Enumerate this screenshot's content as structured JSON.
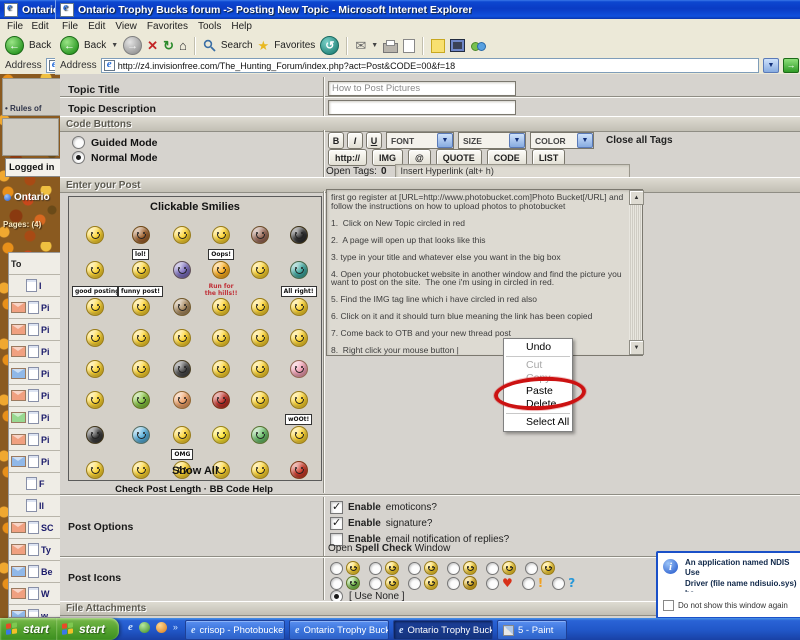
{
  "colors": {
    "titlebar_blue": "#0b47d0",
    "taskbar_blue": "#2a63d6",
    "start_green": "#58a532",
    "annotation_red": "#cc1212",
    "dialog_border": "#1a50c8",
    "page_gray": "#d6d3ce"
  },
  "outer_window": {
    "title": "Ontario Tr",
    "menu": "File   Edit   Vi",
    "back_label": "Back",
    "address_label": "Address",
    "address_value": "ht"
  },
  "window": {
    "title": "Ontario Trophy Bucks forum -> Posting New Topic - Microsoft Internet Explorer",
    "menu_items": [
      "File",
      "Edit",
      "View",
      "Favorites",
      "Tools",
      "Help"
    ],
    "toolbar": {
      "back_label": "Back",
      "search_label": "Search",
      "favorites_label": "Favorites"
    },
    "address_label": "Address",
    "address_value": "http://z4.invisionfree.com/The_Hunting_Forum/index.php?act=Post&CODE=00&f=18"
  },
  "left_panel": {
    "rules_link": "• Rules of",
    "logged_in": "Logged in",
    "ontario": "Ontario",
    "pages": "Pages: (4)",
    "rows": [
      {
        "h": "To"
      },
      {
        "t": "I"
      },
      {
        "e": "o",
        "t": "Pi"
      },
      {
        "e": "o",
        "t": "Pi"
      },
      {
        "e": "o",
        "t": "Pi"
      },
      {
        "e": "b",
        "t": "Pi"
      },
      {
        "e": "o",
        "t": "Pi"
      },
      {
        "e": "g",
        "t": "Pi"
      },
      {
        "e": "o",
        "t": "Pi"
      },
      {
        "e": "b",
        "t": "Pi"
      },
      {
        "t": "F"
      },
      {
        "t": "Il"
      },
      {
        "e": "o",
        "t": "SC"
      },
      {
        "e": "o",
        "t": "Ty"
      },
      {
        "e": "b",
        "t": "Be"
      },
      {
        "e": "o",
        "t": "W"
      },
      {
        "e": "b",
        "t": "w"
      }
    ]
  },
  "form": {
    "topic_title_label": "Topic Title",
    "topic_title_value": "How to Post Pictures",
    "topic_description_label": "Topic Description",
    "topic_description_value": "",
    "code_buttons_header": "Code Buttons",
    "guided_mode_label": "Guided Mode",
    "normal_mode_label": "Normal Mode",
    "style_buttons": [
      "B",
      "I",
      "U"
    ],
    "font_select": "FONT",
    "size_select": "SIZE",
    "color_select": "COLOR",
    "close_all_tags": "Close all Tags",
    "tag_buttons": [
      "http://",
      "IMG",
      "@",
      "QUOTE",
      "CODE",
      "LIST"
    ],
    "open_tags_label": "Open Tags:",
    "open_tags_count": "0",
    "hyperlink_hint": "Insert Hyperlink (alt+ h)",
    "enter_post_header": "Enter your Post",
    "smilies_title": "Clickable Smilies",
    "show_all_label": "Show All",
    "check_post_length_label": "Check Post Length",
    "links_separator": "·",
    "bb_code_help_label": "BB Code Help",
    "smilies": [
      [
        {
          "c": "#ffd630"
        },
        {
          "c": "#a0622d"
        },
        {
          "c": "#ffd630"
        },
        {
          "c": "#ffd630"
        },
        {
          "c": "#9a6a58"
        },
        {
          "c": "#2f2f2f"
        }
      ],
      [
        {
          "c": "#ffd630"
        },
        {
          "c": "#ffd630",
          "s": "lol!"
        },
        {
          "c": "#7d6fc0"
        },
        {
          "c": "#ffb020",
          "s": "Oops!"
        },
        {
          "c": "#ffd630"
        },
        {
          "c": "#3fa8a0"
        }
      ],
      [
        {
          "c": "#ffd630",
          "s": "good posting!"
        },
        {
          "c": "#ffd630",
          "s": "funny post!"
        },
        {
          "c": "#a98a5f"
        },
        {
          "c": "#ffd630",
          "r": "Run for\nthe hills!!"
        },
        {
          "c": "#ffd630"
        },
        {
          "c": "#ffd630",
          "s": "All right!"
        }
      ],
      [
        {
          "c": "#ffd630"
        },
        {
          "c": "#ffd630"
        },
        {
          "c": "#ffd630"
        },
        {
          "c": "#ffd630"
        },
        {
          "c": "#ffd630"
        },
        {
          "c": "#ffd630"
        }
      ],
      [
        {
          "c": "#ffd630"
        },
        {
          "c": "#ffd630"
        },
        {
          "c": "#4a4a4a"
        },
        {
          "c": "#ffd630"
        },
        {
          "c": "#ffd630"
        },
        {
          "c": "#f2a0b4"
        }
      ],
      [
        {
          "c": "#ffd630"
        },
        {
          "c": "#86c540"
        },
        {
          "c": "#f0a268"
        },
        {
          "c": "#c03028"
        },
        {
          "c": "#ffd630"
        },
        {
          "c": "#ffd630"
        }
      ],
      [
        {
          "c": "#3a3a3a"
        },
        {
          "c": "#57b0dc"
        },
        {
          "c": "#ffd630"
        },
        {
          "c": "#ffe630"
        },
        {
          "c": "#6abf69"
        },
        {
          "c": "#ffd630",
          "s": "wOOt!"
        }
      ],
      [
        {
          "c": "#ffd630"
        },
        {
          "c": "#ffd630"
        },
        {
          "c": "#ffd630",
          "s": "OMG"
        },
        {
          "c": "#ffd630"
        },
        {
          "c": "#ffd630"
        },
        {
          "c": "#cc3a2a"
        }
      ]
    ],
    "post_text": "first go register at [URL=http://www.photobucket.com]Photo Bucket[/URL] and follow the instructions on how to upload photos to photobucket\n\n1.  Click on New Topic circled in red\n\n2.  A page will open up that looks like this\n\n3. type in your title and whatever else you want in the big box\n\n4. Open your photobucket website in another window and find the picture you want to post on the site.  The one i'm using in circled in red.\n\n5. Find the IMG tag line which i have circled in red also\n\n6. Click on it and it should turn blue meaning the link has been copied\n\n7. Come back to OTB and your new thread post\n\n8.  Right click your mouse button |",
    "post_options_label": "Post Options",
    "options": [
      {
        "bold": "Enable",
        "rest": "emoticons?",
        "checked": true
      },
      {
        "bold": "Enable",
        "rest": "signature?",
        "checked": true
      },
      {
        "bold": "Enable",
        "rest": "email notification of replies?",
        "checked": false
      }
    ],
    "spell_check_prefix": "Open",
    "spell_check_bold": "Spell Check",
    "spell_check_suffix": "Window",
    "post_icons_label": "Post Icons",
    "post_icon_rows": [
      [
        {
          "c": "#ffd630"
        },
        {
          "c": "#ffd630"
        },
        {
          "c": "#ffd630"
        },
        {
          "c": "#ffd630"
        },
        {
          "c": "#ffd630"
        },
        {
          "c": "#ffd630"
        }
      ],
      [
        {
          "c": "#7ec850"
        },
        {
          "c": "#ffd630"
        },
        {
          "c": "#ffd630"
        },
        {
          "c": "#e8b820"
        },
        {
          "g": "♥",
          "c": "#d83018"
        },
        {
          "g": "!",
          "c": "#f0a020"
        },
        {
          "g": "?",
          "c": "#2898d8"
        }
      ]
    ],
    "use_none_label": "[ Use None ]",
    "file_attachments_header": "File Attachments"
  },
  "context_menu": {
    "items": [
      {
        "label": "Undo"
      },
      {
        "sep": true
      },
      {
        "label": "Cut",
        "disabled": true
      },
      {
        "label": "Copy",
        "disabled": true
      },
      {
        "label": "Paste",
        "circled": true
      },
      {
        "label": "Delete"
      },
      {
        "sep": true
      },
      {
        "label": "Select All"
      }
    ]
  },
  "dialog": {
    "lines": "An application named NDIS Use\nDriver (file name ndisuio.sys) ha\nblocked from accessing the netw",
    "checkbox_label": "Do not show this window again"
  },
  "taskbar": {
    "start_label": "start",
    "buttons": [
      {
        "icon": "ie",
        "label": "crisop - Photobucket ..."
      },
      {
        "icon": "ie",
        "label": "Ontario Trophy Bucks..."
      },
      {
        "icon": "ie",
        "label": "Ontario Trophy Bucks...",
        "active": true
      },
      {
        "icon": "paint",
        "label": "5 - Paint"
      }
    ]
  }
}
